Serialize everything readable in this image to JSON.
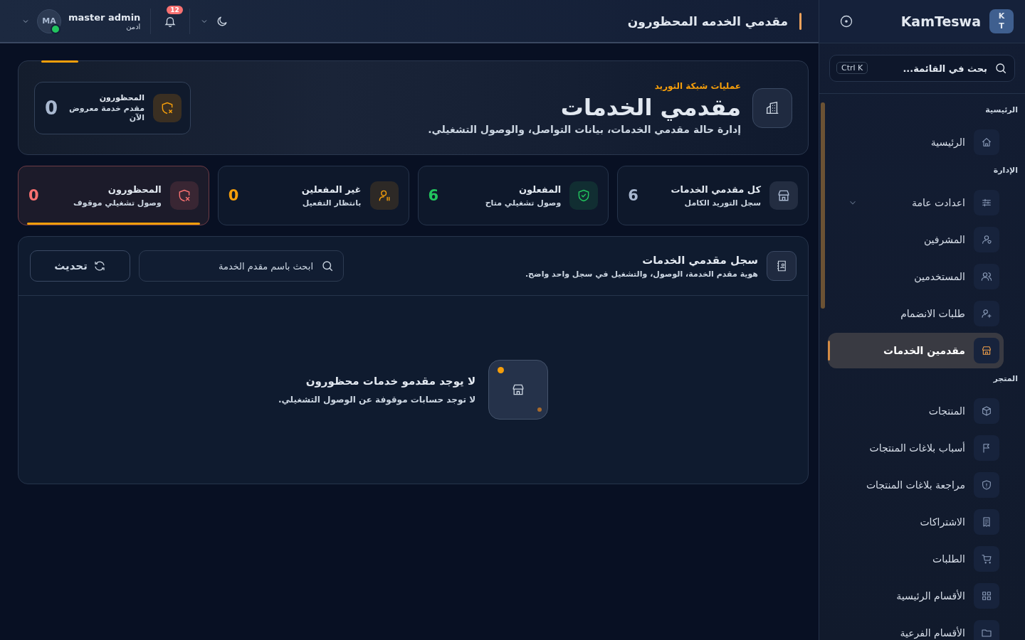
{
  "sidebar": {
    "brand": {
      "logo_letters": [
        "K",
        "T"
      ],
      "name": "KamTeswa"
    },
    "search": {
      "placeholder": "بحث في القائمة...",
      "shortcut": "Ctrl K"
    },
    "sections": [
      {
        "title": "الرئيسية",
        "items": [
          {
            "label": "الرئيسية",
            "selected": false
          }
        ]
      },
      {
        "title": "الإدارة",
        "items": [
          {
            "label": "اعدادت عامة",
            "selected": false,
            "expanded": false
          },
          {
            "label": "المشرفين",
            "selected": false
          },
          {
            "label": "المستخدمين",
            "selected": false
          },
          {
            "label": "طلبات الانضمام",
            "selected": false
          },
          {
            "label": "مقدمين الخدمات",
            "selected": true
          }
        ]
      },
      {
        "title": "المتجر",
        "items": [
          {
            "label": "المنتجات",
            "selected": false
          },
          {
            "label": "أسباب بلاغات المنتجات",
            "selected": false
          },
          {
            "label": "مراجعة بلاغات المنتجات",
            "selected": false
          },
          {
            "label": "الاشتراكات",
            "selected": false
          },
          {
            "label": "الطلبات",
            "selected": false
          },
          {
            "label": "الأقسام الرئيسية",
            "selected": false
          },
          {
            "label": "الأقسام الفرعية",
            "selected": false
          }
        ]
      }
    ]
  },
  "header": {
    "title": "مقدمي الخدمه المحظورون",
    "user": {
      "name": "master admin",
      "role": "ادمن",
      "initials": "MA",
      "online": true
    },
    "notifications": "12"
  },
  "hero": {
    "eyebrow": "عمليات شبكة التوريد",
    "title": "مقدمي الخدمات",
    "description": "إدارة حالة مقدمي الخدمات، بيانات التواصل، والوصول التشغيلي.",
    "summary": {
      "title": "المحظورون",
      "caption": "مقدم خدمة معروض الآن",
      "value": "0"
    }
  },
  "stats": [
    {
      "title": "كل مقدمي الخدمات",
      "caption": "سجل التوريد الكامل",
      "value": "6",
      "color": "#a9b8d0",
      "selected": false
    },
    {
      "title": "المفعلون",
      "caption": "وصول تشغيلي متاح",
      "value": "6",
      "color": "#22c55e",
      "selected": false
    },
    {
      "title": "غير المفعلين",
      "caption": "بانتظار التفعيل",
      "value": "0",
      "color": "#f59e0b",
      "selected": false
    },
    {
      "title": "المحظورون",
      "caption": "وصول تشغيلي موقوف",
      "value": "0",
      "color": "#f87171",
      "selected": true
    }
  ],
  "registry": {
    "title": "سجل مقدمي الخدمات",
    "subtitle": "هوية مقدم الخدمة، الوصول، والتشغيل في سجل واحد واضح.",
    "search": {
      "placeholder": "ابحث باسم مقدم الخدمة"
    },
    "refresh": "تحديث",
    "empty": {
      "title": "لا يوجد مقدمو خدمات محظورون",
      "message": "لا توجد حسابات موقوفة عن الوصول التشغيلي."
    }
  }
}
